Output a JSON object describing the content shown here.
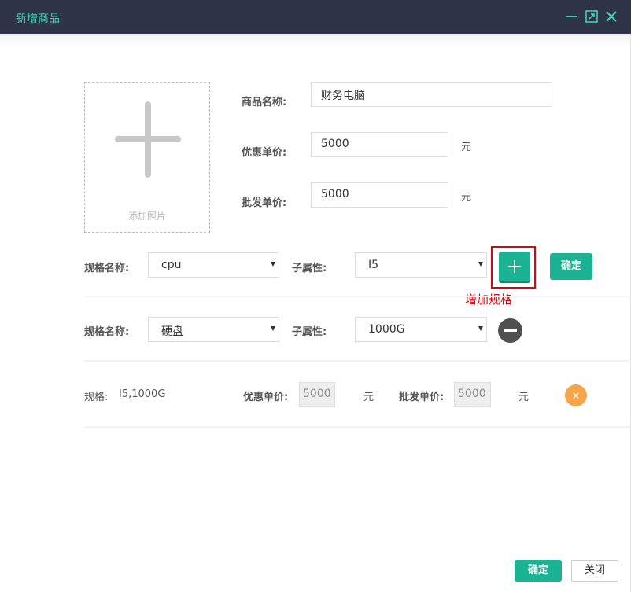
{
  "window": {
    "title": "新增商品",
    "controls": [
      "minimize-icon",
      "maximize-icon",
      "close-icon"
    ]
  },
  "photo": {
    "label": "添加照片"
  },
  "product": {
    "name_label": "商品名称:",
    "name_value": "财务电脑",
    "discount_label": "优惠单价:",
    "discount_value": "5000",
    "discount_unit": "元",
    "wholesale_label": "批发单价:",
    "wholesale_value": "5000",
    "wholesale_unit": "元"
  },
  "spec_row1": {
    "name_label": "规格名称:",
    "name_value": "cpu",
    "sub_label": "子属性:",
    "sub_value": "I5",
    "confirm_label": "确定",
    "annotation": "增加规格"
  },
  "spec_row2": {
    "name_label": "规格名称:",
    "name_value": "硬盘",
    "sub_label": "子属性:",
    "sub_value": "1000G"
  },
  "sku": {
    "spec_label": "规格:",
    "spec_value": "I5,1000G",
    "discount_label": "优惠单价:",
    "discount_value": "5000",
    "discount_unit": "元",
    "wholesale_label": "批发单价:",
    "wholesale_value": "5000",
    "wholesale_unit": "元",
    "remove_glyph": "×"
  },
  "footer": {
    "confirm_label": "确定",
    "close_label": "关闭"
  },
  "colors": {
    "titlebar": "#2f3448",
    "accent": "#3fd3b8",
    "primary": "#1bb394",
    "danger": "#e3000b",
    "remove": "#f7a54a"
  }
}
